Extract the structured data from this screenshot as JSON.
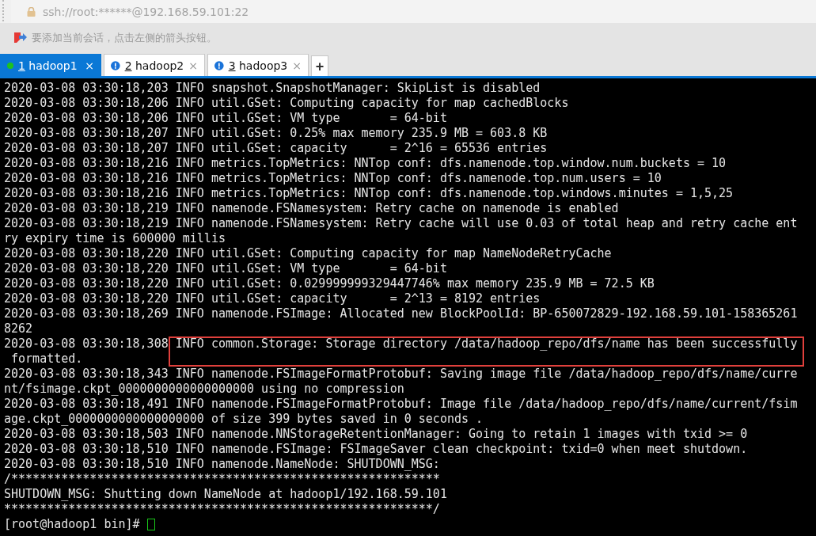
{
  "address_bar": {
    "text": "ssh://root:******@192.168.59.101:22"
  },
  "hint_bar": {
    "text": "要添加当前会话，点击左侧的箭头按钮。"
  },
  "tabs": [
    {
      "number": "1",
      "label": "hadoop1",
      "selected": true,
      "kind": "connected",
      "close": "×"
    },
    {
      "number": "2",
      "label": "hadoop2",
      "selected": false,
      "kind": "alert",
      "close": "×"
    },
    {
      "number": "3",
      "label": "hadoop3",
      "selected": false,
      "kind": "alert",
      "close": "×"
    }
  ],
  "new_tab": "+",
  "terminal": {
    "rows": [
      {
        "kind": "line",
        "text": "2020-03-08 03:30:18,203 INFO snapshot.SnapshotManager: SkipList is disabled"
      },
      {
        "kind": "line",
        "text": "2020-03-08 03:30:18,206 INFO util.GSet: Computing capacity for map cachedBlocks"
      },
      {
        "kind": "line",
        "text": "2020-03-08 03:30:18,206 INFO util.GSet: VM type       = 64-bit"
      },
      {
        "kind": "line",
        "text": "2020-03-08 03:30:18,207 INFO util.GSet: 0.25% max memory 235.9 MB = 603.8 KB"
      },
      {
        "kind": "line",
        "text": "2020-03-08 03:30:18,207 INFO util.GSet: capacity      = 2^16 = 65536 entries"
      },
      {
        "kind": "line",
        "text": "2020-03-08 03:30:18,216 INFO metrics.TopMetrics: NNTop conf: dfs.namenode.top.window.num.buckets = 10"
      },
      {
        "kind": "line",
        "text": "2020-03-08 03:30:18,216 INFO metrics.TopMetrics: NNTop conf: dfs.namenode.top.num.users = 10"
      },
      {
        "kind": "line",
        "text": "2020-03-08 03:30:18,216 INFO metrics.TopMetrics: NNTop conf: dfs.namenode.top.windows.minutes = 1,5,25"
      },
      {
        "kind": "line",
        "text": "2020-03-08 03:30:18,219 INFO namenode.FSNamesystem: Retry cache on namenode is enabled"
      },
      {
        "kind": "line",
        "text": "2020-03-08 03:30:18,219 INFO namenode.FSNamesystem: Retry cache will use 0.03 of total heap and retry cache ent"
      },
      {
        "kind": "line",
        "text": "ry expiry time is 600000 millis"
      },
      {
        "kind": "line",
        "text": "2020-03-08 03:30:18,220 INFO util.GSet: Computing capacity for map NameNodeRetryCache"
      },
      {
        "kind": "line",
        "text": "2020-03-08 03:30:18,220 INFO util.GSet: VM type       = 64-bit"
      },
      {
        "kind": "line",
        "text": "2020-03-08 03:30:18,220 INFO util.GSet: 0.029999999329447746% max memory 235.9 MB = 72.5 KB"
      },
      {
        "kind": "line",
        "text": "2020-03-08 03:30:18,220 INFO util.GSet: capacity      = 2^13 = 8192 entries"
      },
      {
        "kind": "line",
        "text": "2020-03-08 03:30:18,269 INFO namenode.FSImage: Allocated new BlockPoolId: BP-650072829-192.168.59.101-158365261"
      },
      {
        "kind": "line",
        "text": "8262"
      },
      {
        "kind": "boxed",
        "prefix": "2020-03-08 03:30:18,308",
        "text": "INFO common.Storage: Storage directory /data/hadoop_repo/dfs/name has been successfully",
        "continuation": " formatted."
      },
      {
        "kind": "line",
        "text": "2020-03-08 03:30:18,343 INFO namenode.FSImageFormatProtobuf: Saving image file /data/hadoop_repo/dfs/name/curre"
      },
      {
        "kind": "line",
        "text": "nt/fsimage.ckpt_0000000000000000000 using no compression"
      },
      {
        "kind": "line",
        "text": "2020-03-08 03:30:18,491 INFO namenode.FSImageFormatProtobuf: Image file /data/hadoop_repo/dfs/name/current/fsim"
      },
      {
        "kind": "line",
        "text": "age.ckpt_0000000000000000000 of size 399 bytes saved in 0 seconds ."
      },
      {
        "kind": "line",
        "text": "2020-03-08 03:30:18,503 INFO namenode.NNStorageRetentionManager: Going to retain 1 images with txid >= 0"
      },
      {
        "kind": "line",
        "text": "2020-03-08 03:30:18,510 INFO namenode.FSImage: FSImageSaver clean checkpoint: txid=0 when meet shutdown."
      },
      {
        "kind": "line",
        "text": "2020-03-08 03:30:18,510 INFO namenode.NameNode: SHUTDOWN_MSG:"
      },
      {
        "kind": "line",
        "text": "/************************************************************"
      },
      {
        "kind": "line",
        "text": "SHUTDOWN_MSG: Shutting down NameNode at hadoop1/192.168.59.101"
      },
      {
        "kind": "line",
        "text": "************************************************************/"
      },
      {
        "kind": "prompt",
        "text": "[root@hadoop1 bin]# "
      }
    ]
  }
}
